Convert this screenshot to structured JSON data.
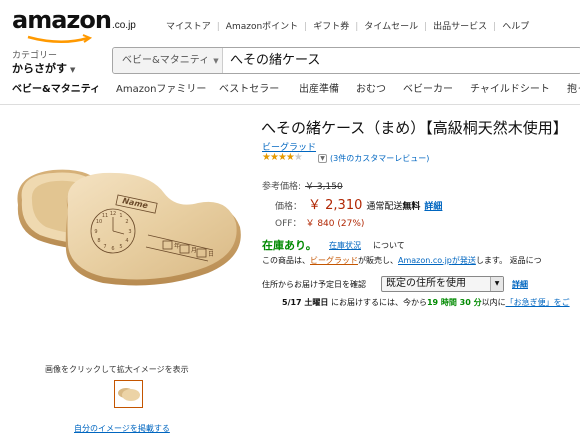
{
  "header": {
    "logo_text": "amazon",
    "logo_tld": ".co.jp",
    "top_links": [
      "マイストア",
      "Amazonポイント",
      "ギフト券",
      "タイムセール",
      "出品サービス",
      "ヘルプ"
    ],
    "category_label": "カテゴリー",
    "category_main": "からさがす",
    "search_department": "ベビー&マタニティ",
    "search_query": "へその緒ケース",
    "nav_items": [
      "ベビー&マタニティ",
      "Amazonファミリー",
      "ベストセラー",
      "出産準備",
      "おむつ",
      "ベビーカー",
      "チャイルドシート",
      "抱っ"
    ]
  },
  "image_panel": {
    "zoom_hint": "画像をクリックして拡大イメージを表示",
    "own_image_link": "自分のイメージを掲載する",
    "engraving": {
      "name_label": "Name",
      "clock_numbers": [
        "12",
        "1",
        "2",
        "3",
        "4",
        "5",
        "6",
        "7",
        "8",
        "9",
        "10",
        "11"
      ],
      "date_fields": [
        "年",
        "月",
        "日"
      ]
    }
  },
  "product": {
    "title": "へその緒ケース（まめ）【高級桐天然木使用】",
    "brand": "ビーグラッド",
    "rating_stars": 4,
    "rating_max": 5,
    "reviews_text": "(3件のカスタマーレビュー)",
    "reference_price_label": "参考価格:",
    "reference_price": "￥ 3,150",
    "price_label": "価格：",
    "price": "￥ 2,310",
    "shipping_prefix": "通常配送",
    "shipping_free": "無料",
    "shipping_detail": "詳細",
    "off_label": "OFF：",
    "off_value": "￥ 840 (27%)",
    "stock": "在庫あり。",
    "stock_status_link": "在庫状況",
    "stock_status_suffix": "について",
    "seller_line": {
      "prefix": "この商品は、",
      "seller": "ビーグラッド",
      "middle": "が販売し、",
      "shipper": "Amazon.co.jp",
      "shipper_suffix": "が発送",
      "suffix": "します。 返品につ"
    },
    "address_label": "住所からお届け予定日を確認",
    "address_select": "既定の住所を使用",
    "address_detail": "詳細",
    "delivery": {
      "date": "5/17 土曜日",
      "mid": "にお届けするには、今から",
      "countdown": "19 時間 30 分",
      "after": "以内に",
      "link": "「お急ぎ便」をご"
    }
  },
  "colors": {
    "price": "#b12704",
    "link": "#0066c0",
    "stock": "#008a00",
    "stars": "#e69a00"
  }
}
